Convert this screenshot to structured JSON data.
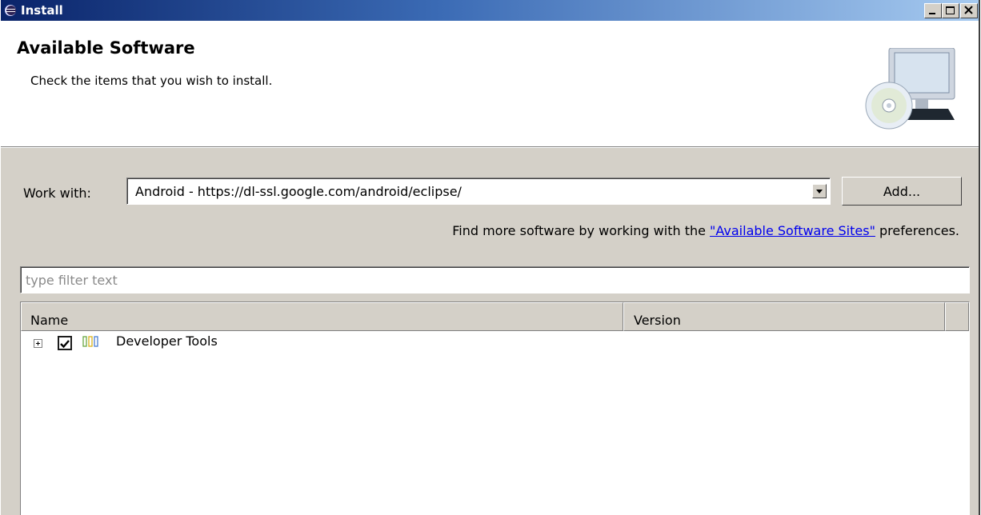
{
  "window": {
    "title": "Install",
    "title_icon": "eclipse-icon",
    "buttons": [
      "minimize-icon",
      "maximize-icon",
      "close-icon"
    ]
  },
  "banner": {
    "title": "Available Software",
    "description": "Check the items that you wish to install.",
    "image": "install-computer-cd-image"
  },
  "work_with": {
    "label": "Work with:",
    "value": "Android - https://dl-ssl.google.com/android/eclipse/",
    "add_button": "Add...",
    "find_more_prefix": "Find more software by working with the ",
    "find_more_link": "\"Available Software Sites\"",
    "find_more_suffix": " preferences."
  },
  "filter": {
    "placeholder": "type filter text",
    "value": ""
  },
  "tree": {
    "columns": [
      "Name",
      "Version"
    ],
    "rows": [
      {
        "label": "Developer Tools",
        "version": "",
        "checked": true,
        "expanded": false,
        "icon": "category-icon"
      }
    ]
  },
  "colors": {
    "title_gradient_start": "#0a246a",
    "title_gradient_end": "#a6caf0",
    "dialog_bg": "#d4d0c8",
    "link": "#0000ee"
  }
}
